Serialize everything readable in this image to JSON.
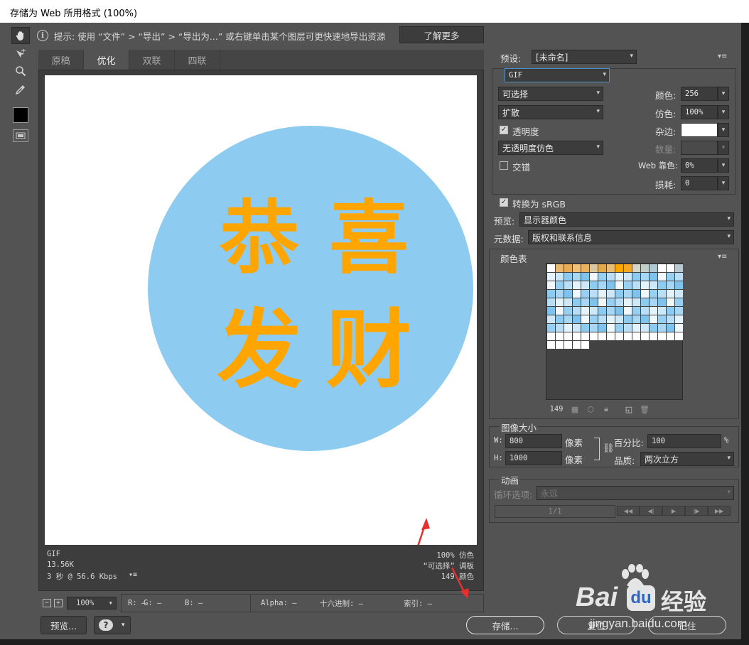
{
  "window": {
    "title": "存储为 Web 所用格式 (100%)"
  },
  "hint": {
    "text": "提示: 使用 “文件” > “导出” > “导出为...” 或右键单击某个图层可更快速地导出资源",
    "learn_more": "了解更多"
  },
  "tabs": [
    "原稿",
    "优化",
    "双联",
    "四联"
  ],
  "image": {
    "circle_color": "#8ecbf0",
    "text_color": "#ffa500",
    "chars": [
      "恭",
      "喜",
      "发",
      "财"
    ]
  },
  "status": {
    "format": "GIF",
    "size": "13.56K",
    "time": "3 秒 @ 56.6 Kbps",
    "dither": "100% 仿色",
    "palette": "“可选择” 调板",
    "colors": "149 颜色"
  },
  "zoom": {
    "value": "100%"
  },
  "readouts": {
    "r": "R: —",
    "g": "G: —",
    "b": "B: —",
    "alpha": "Alpha: —",
    "hex": "十六进制: —",
    "index": "索引: —"
  },
  "buttons": {
    "preview": "预览...",
    "save": "存储...",
    "reset": "复位",
    "remember": "记住",
    "help": "?"
  },
  "settings": {
    "preset_label": "预设:",
    "preset_value": "[未命名]",
    "format": "GIF",
    "reduction": "可选择",
    "dither_algo": "扩散",
    "transparency_label": "透明度",
    "transparency_dither": "无透明度仿色",
    "interlaced_label": "交错",
    "colors_label": "颜色:",
    "colors_value": "256",
    "dither_label": "仿色:",
    "dither_value": "100%",
    "matte_label": "杂边:",
    "matte_color": "#ffffff",
    "amount_label": "数量:",
    "web_snap_label": "Web 靠色:",
    "web_snap_value": "0%",
    "lossy_label": "损耗:",
    "lossy_value": "0",
    "convert_srgb": "转换为 sRGB",
    "preview_label": "预览:",
    "preview_value": "显示器颜色",
    "metadata_label": "元数据:",
    "metadata_value": "版权和联系信息"
  },
  "color_table": {
    "title": "颜色表",
    "count": "149"
  },
  "image_size": {
    "title": "图像大小",
    "w_label": "W:",
    "w_value": "800",
    "h_label": "H:",
    "h_value": "1000",
    "unit": "像素",
    "percent_label": "百分比:",
    "percent_value": "100",
    "percent_unit": "%",
    "quality_label": "品质:",
    "quality_value": "两次立方"
  },
  "animation": {
    "title": "动画",
    "loop_label": "循环选项:",
    "loop_value": "永远",
    "frame": "1/1"
  },
  "watermark": {
    "brand": "Bai",
    "du": "du",
    "cn": "经验",
    "url": "jingyan.baidu.com"
  }
}
